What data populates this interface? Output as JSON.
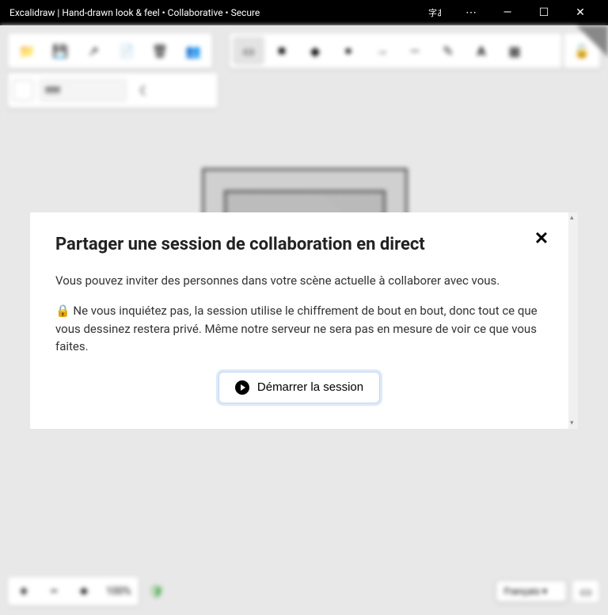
{
  "window": {
    "title": "Excalidraw | Hand-drawn look & feel • Collaborative • Secure"
  },
  "toolbar": {
    "left": [
      "open",
      "save",
      "export",
      "clear",
      "trash",
      "collaborate"
    ],
    "center": [
      "select",
      "rectangle",
      "diamond",
      "ellipse",
      "arrow",
      "line",
      "draw",
      "text",
      "image"
    ]
  },
  "secondary": {
    "color_hex": "ffffff"
  },
  "zoom": {
    "value": "100%"
  },
  "language": {
    "selected": "Français"
  },
  "modal": {
    "title": "Partager une session de collaboration en direct",
    "line1": "Vous pouvez inviter des personnes dans votre scène actuelle à collaborer avec vous.",
    "lock_emoji": "🔒",
    "line2": " Ne vous inquiétez pas, la session utilise le chiffrement de bout en bout, donc tout ce que vous dessinez restera privé. Même notre serveur ne sera pas en mesure de voir ce que vous faites.",
    "start_button": "Démarrer la session"
  }
}
